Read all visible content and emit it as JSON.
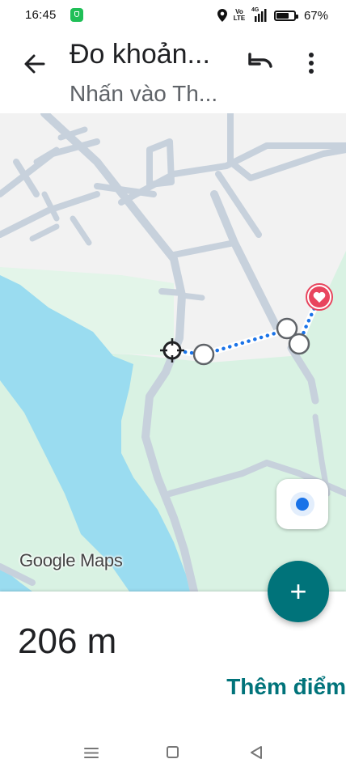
{
  "status_bar": {
    "time": "16:45",
    "volte_label": "Vo LTE",
    "network_label": "4G",
    "battery_percent": "67%",
    "icons": [
      "shield-icon",
      "location-pin-icon",
      "volte-icon",
      "signal-icon",
      "battery-icon"
    ]
  },
  "header": {
    "title": "Đo khoản...",
    "subtitle": "Nhấn vào Th...",
    "icons": [
      "arrow-back-icon",
      "undo-icon",
      "more-vert-icon"
    ]
  },
  "map": {
    "attribution": "Google Maps",
    "measurement": {
      "points": 5,
      "end_marker": "heart-icon",
      "start_marker": "crosshair-icon"
    },
    "colors": {
      "background": "#f2f2f2",
      "park": "#d9f2e3",
      "water": "#9adcf0",
      "road": "#c7d1dc",
      "route": "#1a73e8",
      "heart": "#e8455e"
    }
  },
  "bottom": {
    "distance": "206 m",
    "add_point": "Thêm điểm"
  },
  "fab": {
    "add_symbol": "+",
    "color": "#00737a"
  },
  "nav": {
    "icons": [
      "menu-icon",
      "home-square-icon",
      "back-triangle-icon"
    ]
  }
}
